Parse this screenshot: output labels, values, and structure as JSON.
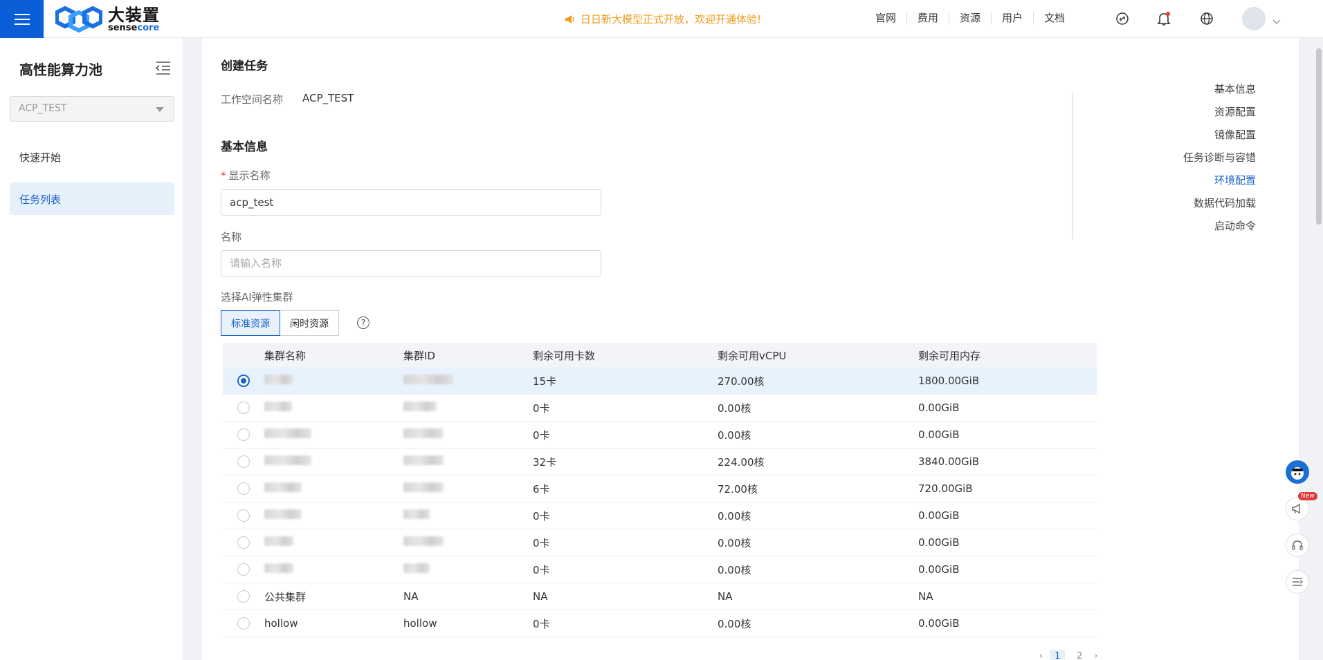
{
  "header": {
    "brand_cn": "大装置",
    "brand_en_a": "sense",
    "brand_en_b": "core",
    "announcement": "日日新大模型正式开放，欢迎开通体验!",
    "nav": [
      "官网",
      "费用",
      "资源",
      "用户",
      "文档"
    ],
    "accent": "#0a5fd8"
  },
  "sidebar": {
    "title": "高性能算力池",
    "workspace": "ACP_TEST",
    "items": [
      {
        "label": "快速开始"
      },
      {
        "label": "任务列表"
      }
    ]
  },
  "form": {
    "title": "创建任务",
    "workspace_label": "工作空间名称",
    "workspace_value": "ACP_TEST",
    "basic_info_title": "基本信息",
    "display_name_label": "显示名称",
    "display_name_value": "acp_test",
    "name_label": "名称",
    "name_placeholder": "请输入名称",
    "cluster_label": "选择AI弹性集群",
    "tabs": [
      "标准资源",
      "闲时资源"
    ]
  },
  "table": {
    "columns": [
      "集群名称",
      "集群ID",
      "剩余可用卡数",
      "剩余可用vCPU",
      "剩余可用内存"
    ],
    "rows": [
      {
        "name": "",
        "id": "",
        "cards": "15卡",
        "vcpu": "270.00核",
        "mem": "1800.00GiB",
        "selected": true
      },
      {
        "name": "",
        "id": "",
        "cards": "0卡",
        "vcpu": "0.00核",
        "mem": "0.00GiB"
      },
      {
        "name": "",
        "id": "",
        "cards": "0卡",
        "vcpu": "0.00核",
        "mem": "0.00GiB"
      },
      {
        "name": "",
        "id": "",
        "cards": "32卡",
        "vcpu": "224.00核",
        "mem": "3840.00GiB"
      },
      {
        "name": "",
        "id": "",
        "cards": "6卡",
        "vcpu": "72.00核",
        "mem": "720.00GiB"
      },
      {
        "name": "",
        "id": "",
        "cards": "0卡",
        "vcpu": "0.00核",
        "mem": "0.00GiB"
      },
      {
        "name": "",
        "id": "",
        "cards": "0卡",
        "vcpu": "0.00核",
        "mem": "0.00GiB"
      },
      {
        "name": "",
        "id": "",
        "cards": "0卡",
        "vcpu": "0.00核",
        "mem": "0.00GiB"
      },
      {
        "name": "公共集群",
        "id": "NA",
        "cards": "NA",
        "vcpu": "NA",
        "mem": "NA"
      },
      {
        "name": "hollow",
        "id": "hollow",
        "cards": "0卡",
        "vcpu": "0.00核",
        "mem": "0.00GiB"
      }
    ],
    "pages": [
      "1",
      "2"
    ]
  },
  "anchor_nav": {
    "items": [
      "基本信息",
      "资源配置",
      "镜像配置",
      "任务诊断与容错",
      "环境配置",
      "数据代码加载",
      "启动命令"
    ],
    "active": "环境配置"
  },
  "float_tools": {
    "new_badge": "New"
  }
}
